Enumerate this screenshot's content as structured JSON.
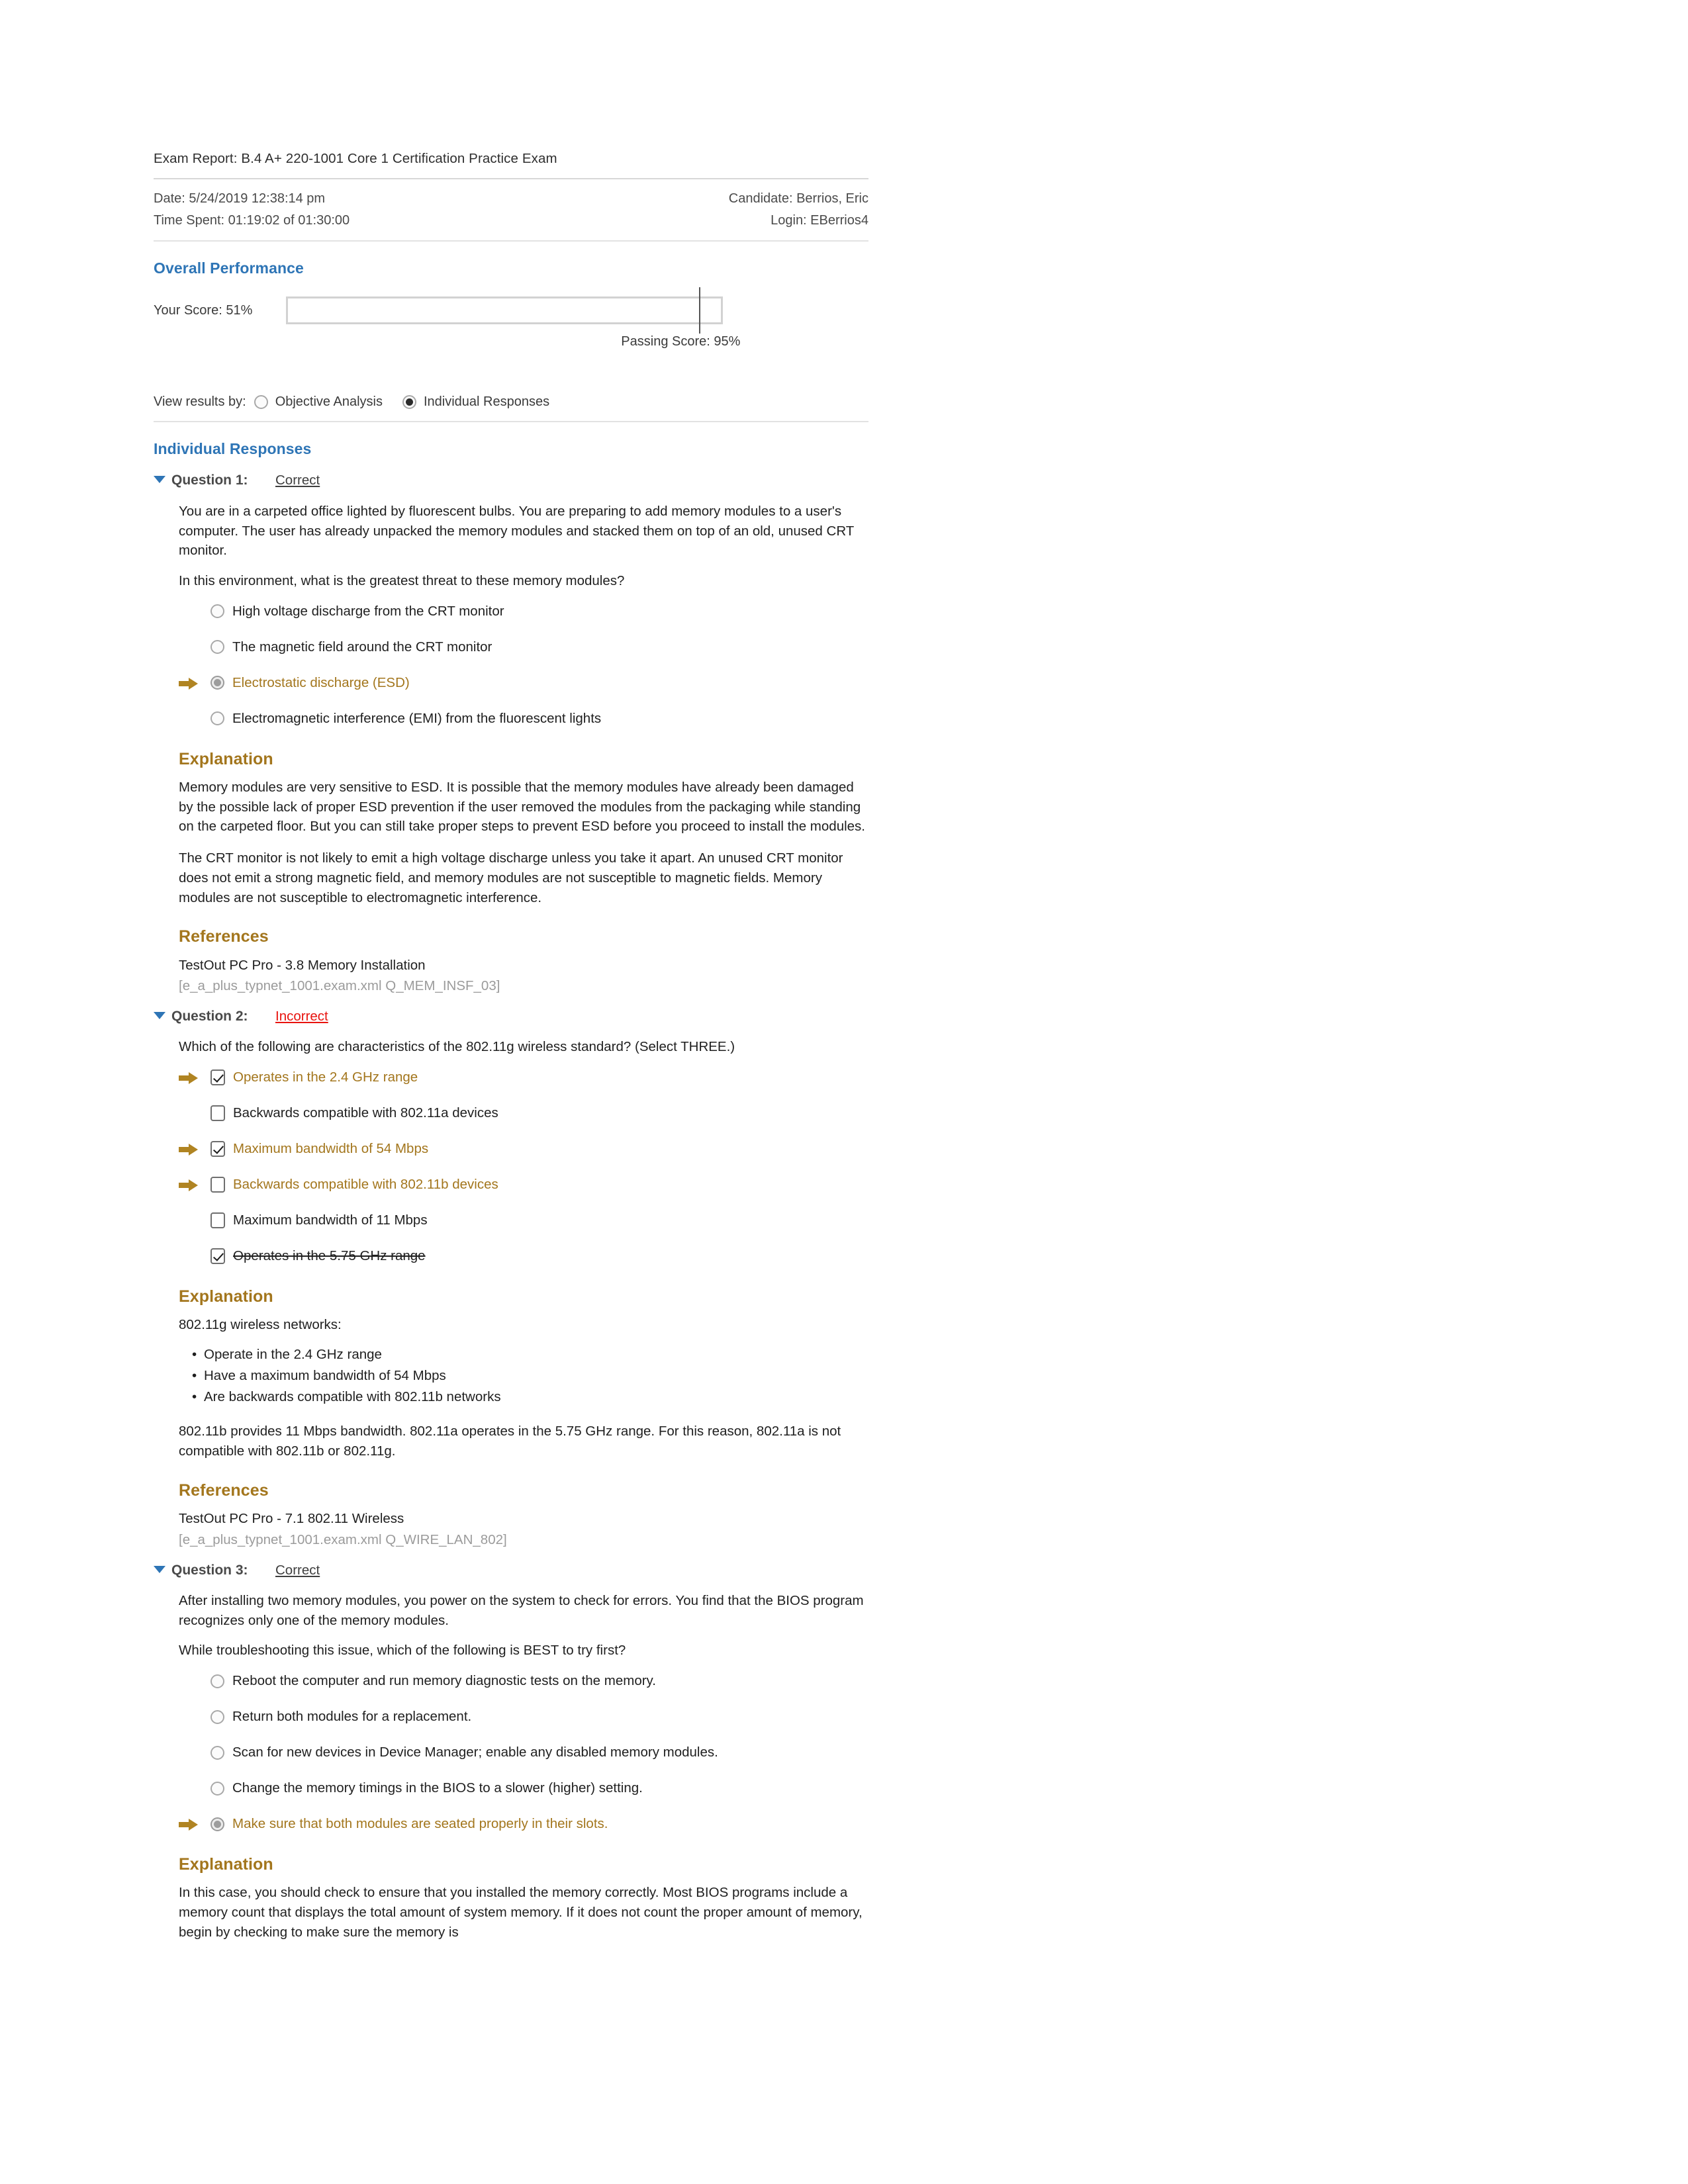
{
  "report": {
    "title": "Exam Report: B.4 A+ 220-1001 Core 1 Certification Practice Exam",
    "date_label": "Date: 5/24/2019 12:38:14 pm",
    "time_spent_label": "Time Spent: 01:19:02 of 01:30:00",
    "candidate_label": "Candidate: Berrios, Eric",
    "login_label": "Login: EBerrios4"
  },
  "overall": {
    "heading": "Overall Performance",
    "your_score_label": "Your Score: 51%",
    "your_score_value": 51,
    "passing_label": "Passing Score: 95%",
    "passing_value": 95
  },
  "view_results": {
    "label": "View results by:",
    "options": [
      {
        "label": "Objective Analysis",
        "selected": false
      },
      {
        "label": "Individual Responses",
        "selected": true
      }
    ]
  },
  "individual_responses": {
    "heading": "Individual Responses"
  },
  "labels": {
    "explanation": "Explanation",
    "references": "References"
  },
  "questions": [
    {
      "number": "Question 1:",
      "verdict": "Correct",
      "verdict_state": "correct",
      "type": "radio",
      "prompt1": "You are in a carpeted office lighted by fluorescent bulbs. You are preparing to add memory modules to a user's computer. The user has already unpacked the memory modules and stacked them on top of an old, unused CRT monitor.",
      "prompt2": "In this environment, what is the greatest threat to these memory modules?",
      "options": [
        {
          "text": "High voltage discharge from the CRT monitor",
          "checked": false,
          "chosen": false,
          "struck": false
        },
        {
          "text": "The magnetic field around the CRT monitor",
          "checked": false,
          "chosen": false,
          "struck": false
        },
        {
          "text": "Electrostatic discharge (ESD)",
          "checked": true,
          "chosen": true,
          "struck": false
        },
        {
          "text": "Electromagnetic interference (EMI) from the fluorescent lights",
          "checked": false,
          "chosen": false,
          "struck": false
        }
      ],
      "explanation": [
        "Memory modules are very sensitive to ESD. It is possible that the memory modules have already been damaged by the possible lack of proper ESD prevention if the user removed the modules from the packaging while standing on the carpeted floor. But you can still take proper steps to prevent ESD before you proceed to install the modules.",
        "The CRT monitor is not likely to emit a high voltage discharge unless you take it apart. An unused CRT monitor does not emit a strong magnetic field, and memory modules are not susceptible to magnetic fields. Memory modules are not susceptible to electromagnetic interference."
      ],
      "bullets": [],
      "reference_title": "TestOut PC Pro - 3.8 Memory Installation",
      "reference_path": "[e_a_plus_typnet_1001.exam.xml Q_MEM_INSF_03]"
    },
    {
      "number": "Question 2:",
      "verdict": "Incorrect",
      "verdict_state": "incorrect",
      "type": "checkbox",
      "prompt1": "Which of the following are characteristics of the 802.11g wireless standard? (Select THREE.)",
      "prompt2": "",
      "options": [
        {
          "text": "Operates in the 2.4 GHz range",
          "checked": true,
          "chosen": true,
          "struck": false
        },
        {
          "text": "Backwards compatible with 802.11a devices",
          "checked": false,
          "chosen": false,
          "struck": false
        },
        {
          "text": "Maximum bandwidth of 54 Mbps",
          "checked": true,
          "chosen": true,
          "struck": false
        },
        {
          "text": "Backwards compatible with 802.11b devices",
          "checked": false,
          "chosen": true,
          "struck": false
        },
        {
          "text": "Maximum bandwidth of 11 Mbps",
          "checked": false,
          "chosen": false,
          "struck": false
        },
        {
          "text": "Operates in the 5.75 GHz range",
          "checked": true,
          "chosen": false,
          "struck": true
        }
      ],
      "explanation_lead": "802.11g wireless networks:",
      "bullets": [
        "Operate in the 2.4 GHz range",
        "Have a maximum bandwidth of 54 Mbps",
        "Are backwards compatible with 802.11b networks"
      ],
      "explanation": [
        "802.11b provides 11 Mbps bandwidth. 802.11a operates in the 5.75 GHz range. For this reason, 802.11a is not compatible with 802.11b or 802.11g."
      ],
      "reference_title": "TestOut PC Pro - 7.1 802.11 Wireless",
      "reference_path": "[e_a_plus_typnet_1001.exam.xml Q_WIRE_LAN_802]"
    },
    {
      "number": "Question 3:",
      "verdict": "Correct",
      "verdict_state": "correct",
      "type": "radio",
      "prompt1": "After installing two memory modules, you power on the system to check for errors. You find that the BIOS program recognizes only one of the memory modules.",
      "prompt2": "While troubleshooting this issue, which of the following is BEST to try first?",
      "options": [
        {
          "text": "Reboot the computer and run memory diagnostic tests on the memory.",
          "checked": false,
          "chosen": false,
          "struck": false
        },
        {
          "text": "Return both modules for a replacement.",
          "checked": false,
          "chosen": false,
          "struck": false
        },
        {
          "text": "Scan for new devices in Device Manager; enable any disabled memory modules.",
          "checked": false,
          "chosen": false,
          "struck": false
        },
        {
          "text": "Change the memory timings in the BIOS to a slower (higher) setting.",
          "checked": false,
          "chosen": false,
          "struck": false
        },
        {
          "text": "Make sure that both modules are seated properly in their slots.",
          "checked": true,
          "chosen": true,
          "struck": false
        }
      ],
      "bullets": [],
      "explanation": [
        "In this case, you should check to ensure that you installed the memory correctly. Most BIOS programs include a memory count that displays the total amount of system memory. If it does not count the proper amount of memory, begin by checking to make sure the memory is"
      ],
      "reference_title": "",
      "reference_path": ""
    }
  ],
  "colors": {
    "accent_blue": "#2e75b6",
    "gold": "#a3761d",
    "incorrect_red": "#e8130e"
  }
}
